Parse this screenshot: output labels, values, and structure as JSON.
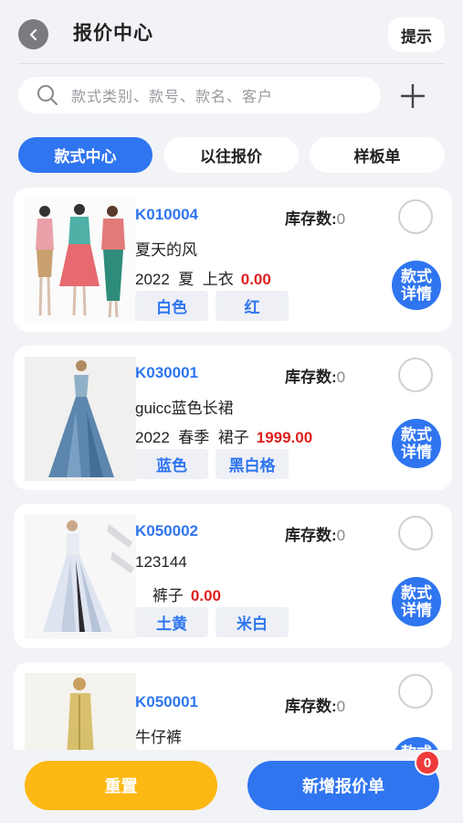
{
  "header": {
    "title": "报价中心",
    "tip_label": "提示",
    "back_icon": "chevron-left-icon"
  },
  "search": {
    "placeholder": "款式类别、款号、款名、客户",
    "add_icon": "plus-icon"
  },
  "tabs": [
    {
      "label": "款式中心",
      "active": true
    },
    {
      "label": "以往报价",
      "active": false
    },
    {
      "label": "样板单",
      "active": false
    }
  ],
  "stock_label": "库存数:",
  "detail_label": "款式详情",
  "products": [
    {
      "code": "K010004",
      "stock": "0",
      "name": "夏天的风",
      "year": "2022",
      "season": "夏",
      "category": "上衣",
      "price": "0.00",
      "colors": [
        "白色",
        "红"
      ]
    },
    {
      "code": "K030001",
      "stock": "0",
      "name": "guicc蓝色长裙",
      "year": "2022",
      "season": "春季",
      "category": "裙子",
      "price": "1999.00",
      "colors": [
        "蓝色",
        "黑白格"
      ]
    },
    {
      "code": "K050002",
      "stock": "0",
      "name": "123144",
      "year": "",
      "season": "",
      "category": "裤子",
      "price": "0.00",
      "colors": [
        "土黄",
        "米白"
      ]
    },
    {
      "code": "K050001",
      "stock": "0",
      "name": "牛仔裤",
      "year": "",
      "season": "",
      "category": "",
      "price": "",
      "colors": []
    }
  ],
  "footer": {
    "reset_label": "重置",
    "new_quote_label": "新增报价单",
    "badge_count": "0"
  },
  "colors": {
    "accent": "#2f75f0",
    "price": "#e02020",
    "reset": "#fdb813",
    "badge": "#ef3a3a"
  }
}
